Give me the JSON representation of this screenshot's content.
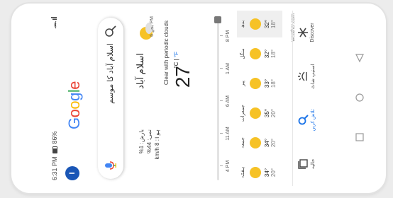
{
  "status": {
    "time": "6:31 PM",
    "battery": "86%"
  },
  "header": {
    "avatar_letter": "I"
  },
  "logo": {
    "text": "Google"
  },
  "search": {
    "query": "اسلام آباد کا موسم"
  },
  "weather": {
    "city": "اسلام آباد",
    "hint": "6 بجے PM",
    "condition": "Clear with periodic clouds",
    "temperature": "27",
    "unit_c": "°C",
    "unit_sep": "|",
    "unit_f": "°F",
    "meta": [
      "بارش: 1%",
      "نمی: 44%",
      "ہوا: 8 km/h"
    ],
    "hours": [
      "4 PM",
      "11 AM",
      "6 AM",
      "1 AM",
      "8 PM"
    ],
    "days": [
      {
        "name": "بدھ",
        "hi": "32°",
        "lo": "18°"
      },
      {
        "name": "منگل",
        "hi": "32°",
        "lo": "18°"
      },
      {
        "name": "پیر",
        "hi": "33°",
        "lo": "18°"
      },
      {
        "name": "جمعرات",
        "hi": "35°",
        "lo": "20°"
      },
      {
        "name": "جمعہ",
        "hi": "34°",
        "lo": "20°"
      },
      {
        "name": "ہفتہ",
        "hi": "34°",
        "lo": "20°"
      }
    ],
    "source": "weather.com"
  },
  "bottomnav": [
    {
      "label": "Discover"
    },
    {
      "label": "اسنیپ شاٹ"
    },
    {
      "label": "تلاش کریں"
    },
    {
      "label": "حالیہ"
    }
  ],
  "colors": {
    "accent": "#1a73e8",
    "sun": "#f6c226",
    "avatar": "#1a56b6"
  }
}
